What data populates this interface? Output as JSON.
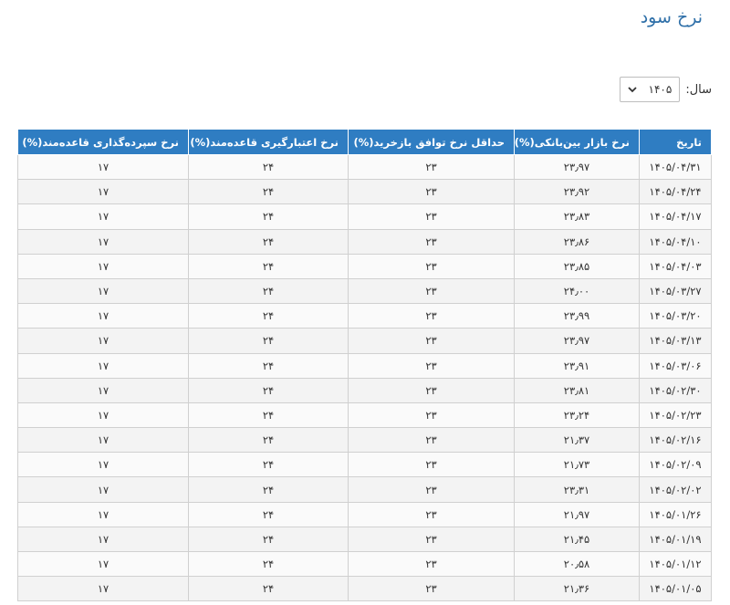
{
  "page": {
    "title": "نرخ سود"
  },
  "filter": {
    "label": "سال:",
    "selected_year": "۱۴۰۵"
  },
  "colors": {
    "header_bg": "#2f7dc2",
    "title": "#2e6fa8"
  },
  "table": {
    "columns": [
      "تاریخ",
      "نرخ بازار بین‌بانکی(%)",
      "حداقل نرخ توافق بازخرید(%)",
      "نرخ اعتبارگیری قاعده‌مند(%)",
      "نرخ سپرده‌گذاری قاعده‌مند(%)"
    ],
    "rows": [
      [
        "۱۴۰۵/۰۴/۳۱",
        "۲۳٫۹۷",
        "۲۳",
        "۲۴",
        "۱۷"
      ],
      [
        "۱۴۰۵/۰۴/۲۴",
        "۲۳٫۹۲",
        "۲۳",
        "۲۴",
        "۱۷"
      ],
      [
        "۱۴۰۵/۰۴/۱۷",
        "۲۳٫۸۳",
        "۲۳",
        "۲۴",
        "۱۷"
      ],
      [
        "۱۴۰۵/۰۴/۱۰",
        "۲۳٫۸۶",
        "۲۳",
        "۲۴",
        "۱۷"
      ],
      [
        "۱۴۰۵/۰۴/۰۳",
        "۲۳٫۸۵",
        "۲۳",
        "۲۴",
        "۱۷"
      ],
      [
        "۱۴۰۵/۰۳/۲۷",
        "۲۴٫۰۰",
        "۲۳",
        "۲۴",
        "۱۷"
      ],
      [
        "۱۴۰۵/۰۳/۲۰",
        "۲۳٫۹۹",
        "۲۳",
        "۲۴",
        "۱۷"
      ],
      [
        "۱۴۰۵/۰۳/۱۳",
        "۲۳٫۹۷",
        "۲۳",
        "۲۴",
        "۱۷"
      ],
      [
        "۱۴۰۵/۰۳/۰۶",
        "۲۳٫۹۱",
        "۲۳",
        "۲۴",
        "۱۷"
      ],
      [
        "۱۴۰۵/۰۲/۳۰",
        "۲۳٫۸۱",
        "۲۳",
        "۲۴",
        "۱۷"
      ],
      [
        "۱۴۰۵/۰۲/۲۳",
        "۲۳٫۲۴",
        "۲۳",
        "۲۴",
        "۱۷"
      ],
      [
        "۱۴۰۵/۰۲/۱۶",
        "۲۱٫۳۷",
        "۲۳",
        "۲۴",
        "۱۷"
      ],
      [
        "۱۴۰۵/۰۲/۰۹",
        "۲۱٫۷۳",
        "۲۳",
        "۲۴",
        "۱۷"
      ],
      [
        "۱۴۰۵/۰۲/۰۲",
        "۲۳٫۳۱",
        "۲۳",
        "۲۴",
        "۱۷"
      ],
      [
        "۱۴۰۵/۰۱/۲۶",
        "۲۱٫۹۷",
        "۲۳",
        "۲۴",
        "۱۷"
      ],
      [
        "۱۴۰۵/۰۱/۱۹",
        "۲۱٫۴۵",
        "۲۳",
        "۲۴",
        "۱۷"
      ],
      [
        "۱۴۰۵/۰۱/۱۲",
        "۲۰٫۵۸",
        "۲۳",
        "۲۴",
        "۱۷"
      ],
      [
        "۱۴۰۵/۰۱/۰۵",
        "۲۱٫۳۶",
        "۲۳",
        "۲۴",
        "۱۷"
      ]
    ]
  }
}
